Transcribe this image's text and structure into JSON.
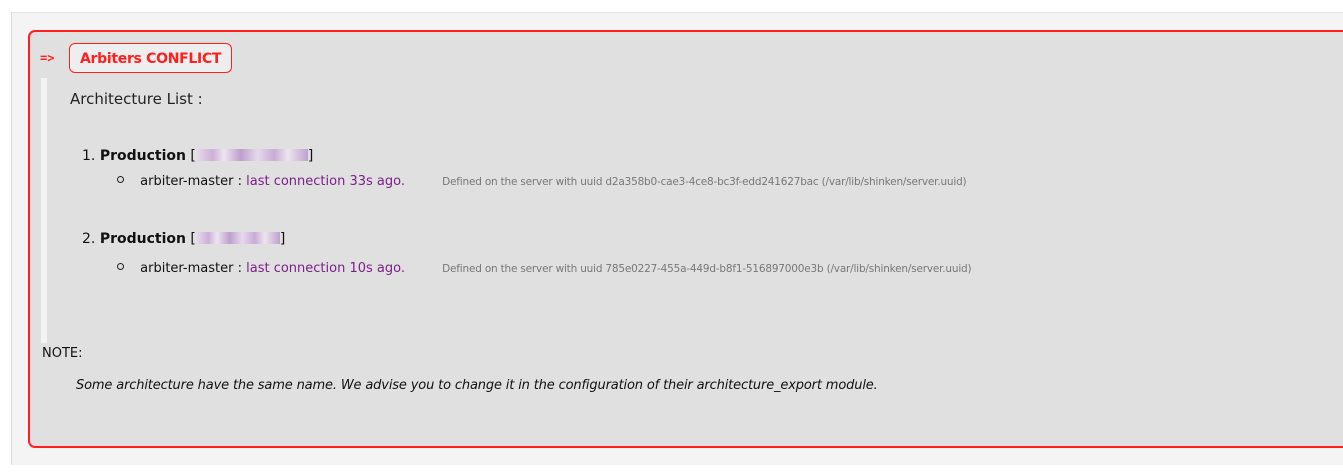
{
  "colors": {
    "accent": "#ff1f1f",
    "panel_bg": "#e0e0e0",
    "link": "#7a2087"
  },
  "header": {
    "arrow": "=>",
    "badge_label": "Arbiters CONFLICT"
  },
  "architecture": {
    "title": "Architecture List :",
    "items": [
      {
        "number": "1.",
        "name": "Production",
        "ip_open": "[",
        "ip_close": "]",
        "arbiter": "arbiter-master :",
        "connection": "last connection 33s ago.",
        "detail": "Defined on the server with uuid d2a358b0-cae3-4ce8-bc3f-edd241627bac (/var/lib/shinken/server.uuid)"
      },
      {
        "number": "2.",
        "name": "Production",
        "ip_open": "[",
        "ip_close": "]",
        "arbiter": "arbiter-master :",
        "connection": "last connection 10s ago.",
        "detail": "Defined on the server with uuid 785e0227-455a-449d-b8f1-516897000e3b (/var/lib/shinken/server.uuid)"
      }
    ]
  },
  "note": {
    "label": "NOTE:",
    "text": "Some architecture have the same name. We advise you to change it in the configuration of their architecture_export module."
  }
}
